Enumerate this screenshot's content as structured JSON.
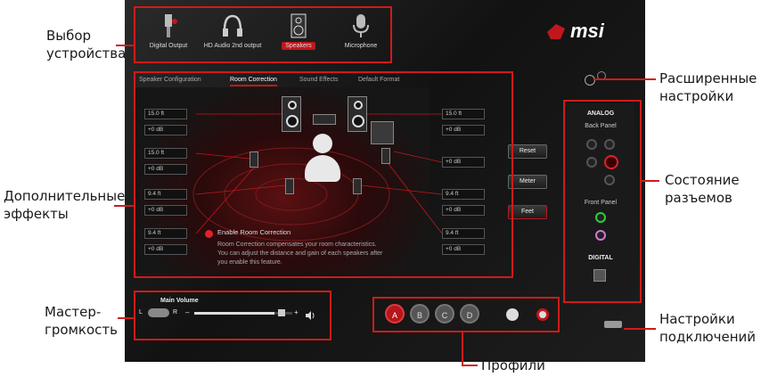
{
  "callouts": {
    "device_select": [
      "Выбор",
      "устройства"
    ],
    "extra_effects": [
      "Дополнительные",
      "эффекты"
    ],
    "master_volume": [
      "Мастер-",
      "громкость"
    ],
    "advanced_settings": [
      "Расширенные",
      "настройки"
    ],
    "jack_status": [
      "Состояние",
      "разъемов"
    ],
    "connection_settings": [
      "Настройки",
      "подключений"
    ],
    "profiles": "Профили"
  },
  "devices": [
    {
      "label": "Digital Output",
      "icon": "digital-output-icon"
    },
    {
      "label": "HD Audio 2nd output",
      "icon": "headphones-icon"
    },
    {
      "label": "Speakers",
      "icon": "speaker-icon"
    },
    {
      "label": "Microphone",
      "icon": "microphone-icon"
    }
  ],
  "brand": "msi",
  "tabs": [
    "Speaker Configuration",
    "Room Correction",
    "Sound Effects",
    "Default Format"
  ],
  "room": {
    "left_fields": [
      {
        "dist": "15.0 ft",
        "gain": "+0 dB"
      },
      {
        "dist": "15.0 ft",
        "gain": "+0 dB"
      },
      {
        "dist": "9.4 ft",
        "gain": "+0 dB"
      },
      {
        "dist": "9.4 ft",
        "gain": "+0 dB"
      }
    ],
    "right_fields": [
      {
        "dist": "15.0 ft",
        "gain": "+0 dB"
      },
      {
        "dist": "",
        "gain": "+0 dB"
      },
      {
        "dist": "9.4 ft",
        "gain": "+0 dB"
      },
      {
        "dist": "9.4 ft",
        "gain": "+0 dB"
      }
    ],
    "buttons": {
      "reset": "Reset",
      "meter": "Meter",
      "feet": "Feet"
    },
    "enable_label": "Enable Room Correction",
    "description": [
      "Room Correction compensates your room characteristics.",
      "You can adjust the distance and gain of each speakers after",
      "you enable this feature."
    ]
  },
  "volume": {
    "title": "Main Volume",
    "left": "L",
    "right": "R",
    "minus": "–",
    "plus": "+",
    "level": 0.82
  },
  "profiles": [
    "A",
    "B",
    "C",
    "D"
  ],
  "analog": {
    "title": "ANALOG",
    "back_panel": "Back Panel",
    "front_panel": "Front Panel",
    "digital": "DIGITAL"
  },
  "colors": {
    "accent": "#c0171c",
    "callout_line": "#d11a1a",
    "jack_green": "#2ecc40",
    "jack_pink": "#d07ad0",
    "jack_red": "#e0202a"
  }
}
